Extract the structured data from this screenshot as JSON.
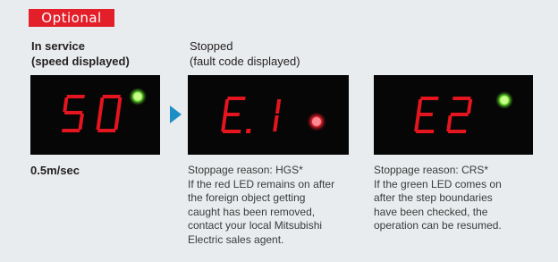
{
  "badge": "Optional",
  "columns": [
    {
      "heading": [
        "In service",
        "(speed displayed)"
      ],
      "display": "50",
      "led": "green",
      "caption": "0.5m/sec"
    },
    {
      "heading": [
        "Stopped",
        "(fault code displayed)"
      ],
      "display": "E.1",
      "led": "red",
      "caption": [
        "Stoppage reason: HGS*",
        "If the red LED remains on after",
        "the foreign object getting",
        "caught has been removed,",
        "contact your local Mitsubishi",
        "Electric sales agent."
      ]
    },
    {
      "display": "E2",
      "led": "green",
      "caption": [
        "Stoppage reason: CRS*",
        "If the green LED comes on",
        "after the step boundaries",
        "have been checked, the",
        "operation can be resumed."
      ]
    }
  ],
  "colors": {
    "badge": "#e3202a",
    "arrow": "#1d8fc6",
    "segment": "#e5151f",
    "led_green": "#7dff3a",
    "led_red": "#ff2f3c"
  }
}
